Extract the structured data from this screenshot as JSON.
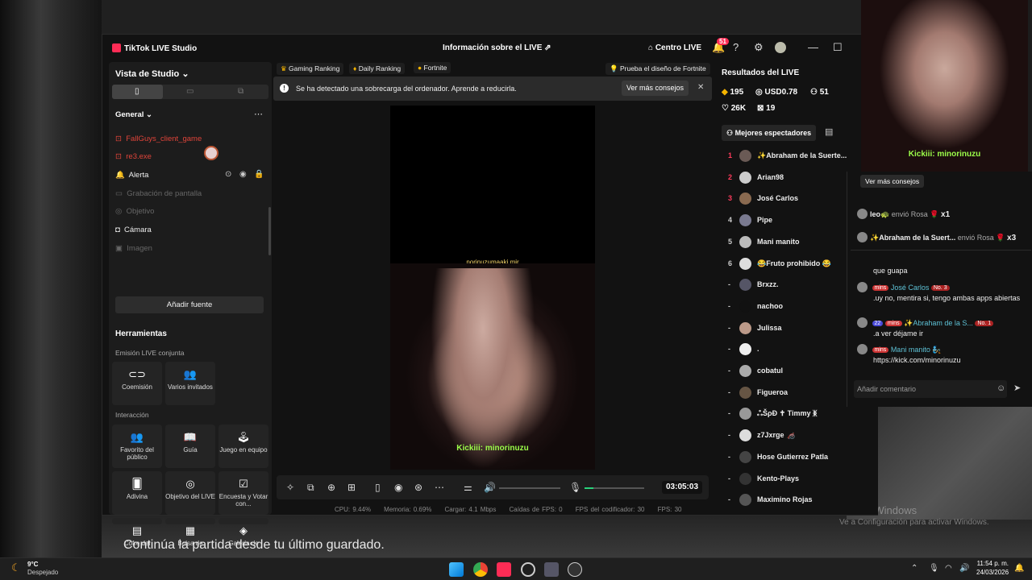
{
  "desktop": {
    "subtitle": "Continúa la partida desde tu último guardado.",
    "activate_title": "Activar Windows",
    "activate_sub": "Ve a Configuración para activar Windows."
  },
  "app": {
    "brand": "TikTok LIVE Studio",
    "live_info": "Información sobre el LIVE",
    "live_center": "Centro LIVE",
    "notif_count": "51",
    "icons": [
      "share-icon",
      "home-icon",
      "bell-icon",
      "help-icon",
      "gear-icon",
      "profile-icon",
      "minimize-icon",
      "maximize-icon"
    ]
  },
  "sidebar": {
    "view_label": "Vista de Studio",
    "section": "General",
    "sources": [
      {
        "label": "FallGuys_client_game",
        "state": "error"
      },
      {
        "label": "re3.exe",
        "state": "error"
      },
      {
        "label": "Alerta",
        "state": "active"
      },
      {
        "label": "Grabación de pantalla",
        "state": "hidden"
      },
      {
        "label": "Objetivo",
        "state": "hidden"
      },
      {
        "label": "Cámara",
        "state": "active"
      },
      {
        "label": "Imagen",
        "state": "hidden"
      }
    ],
    "add_source": "Añadir fuente",
    "tools_title": "Herramientas",
    "collab_label": "Emisión LIVE conjunta",
    "collab": [
      "Coemisión",
      "Varios invitados"
    ],
    "interaction_label": "Interacción",
    "interaction": [
      "Favorito del público",
      "Guía",
      "Juego en equipo",
      "Adivina",
      "Objetivo del LIVE",
      "Encuesta y Votar con...",
      "Cofre del",
      "Bolsa de",
      "Galería de"
    ]
  },
  "tabs": [
    "Gaming Ranking",
    "Daily Ranking",
    "Fortnite"
  ],
  "promo": "Prueba el diseño de Fortnite",
  "warning": {
    "text": "Se ha detectado una sobrecarga del ordenador. Aprende a reducirla.",
    "button": "Ver más consejos"
  },
  "preview": {
    "top_text": "norinuzumaaki  mir",
    "overlay": "Kickiii: minorinuzu"
  },
  "controls": {
    "timer": "03:05:03",
    "volume_level": 0.1,
    "mic_level": 0.15
  },
  "stats": {
    "cpu": "CPU: 9.44%",
    "mem": "Memoria: 0.69%",
    "load": "Cargar: 4.1 Mbps",
    "fps_drop": "Caídas de FPS: 0",
    "enc_fps": "FPS del codificador: 30",
    "fps": "FPS: 30"
  },
  "results": {
    "title": "Resultados del LIVE",
    "diamonds": "195",
    "usd": "USD0.78",
    "viewers": "51",
    "likes": "26K",
    "gifts": "19",
    "top_label": "Mejores espectadores",
    "viewers_list": [
      {
        "rank": "1",
        "name": "✨Abraham de la Suerte..."
      },
      {
        "rank": "2",
        "name": "Arian98"
      },
      {
        "rank": "3",
        "name": "José Carlos"
      },
      {
        "rank": "4",
        "name": "Pipe"
      },
      {
        "rank": "5",
        "name": "Mani manito"
      },
      {
        "rank": "6",
        "name": "😂Fruto prohibido 😂"
      },
      {
        "rank": "-",
        "name": "Brxzz."
      },
      {
        "rank": "-",
        "name": "nachoo"
      },
      {
        "rank": "-",
        "name": "Julissa"
      },
      {
        "rank": "-",
        "name": "."
      },
      {
        "rank": "-",
        "name": "cobatul"
      },
      {
        "rank": "-",
        "name": "Figueroa"
      },
      {
        "rank": "-",
        "name": "ஃŠρĐ ✝ Timmy ᛤ"
      },
      {
        "rank": "-",
        "name": "z7Jxrge 🦽"
      },
      {
        "rank": "-",
        "name": "Hose Gutierrez Patla"
      },
      {
        "rank": "-",
        "name": "Kento-Plays"
      },
      {
        "rank": "-",
        "name": "Maximino Rojas"
      }
    ]
  },
  "popout": {
    "overlay": "Kickiii: minorinuzu",
    "tip_button": "Ver más consejos"
  },
  "chat": {
    "gifts": [
      {
        "user": "leo🐢",
        "action": "envió Rosa",
        "count": "x1"
      },
      {
        "user": "✨Abraham de la Suert...",
        "action": "envió Rosa",
        "count": "x3"
      }
    ],
    "messages": [
      {
        "user": "",
        "badges": [],
        "text": "que guapa"
      },
      {
        "user": "José Carlos",
        "badges": [
          "mins",
          "No. 3"
        ],
        "text": ".uy no, mentira si, tengo ambas apps abiertas"
      },
      {
        "user": "✨Abraham de la S...",
        "badges": [
          "22",
          "mins",
          "No. 1"
        ],
        "text": ".a ver déjame ir"
      },
      {
        "user": "Mani manito 🧞",
        "badges": [
          "mins"
        ],
        "text": "https://kick.com/minorinuzu"
      }
    ],
    "input_placeholder": "Añadir comentario"
  },
  "taskbar": {
    "temp": "9°C",
    "weather": "Despejado",
    "time": "11:54 p. m.",
    "date": "24/03/2026"
  }
}
